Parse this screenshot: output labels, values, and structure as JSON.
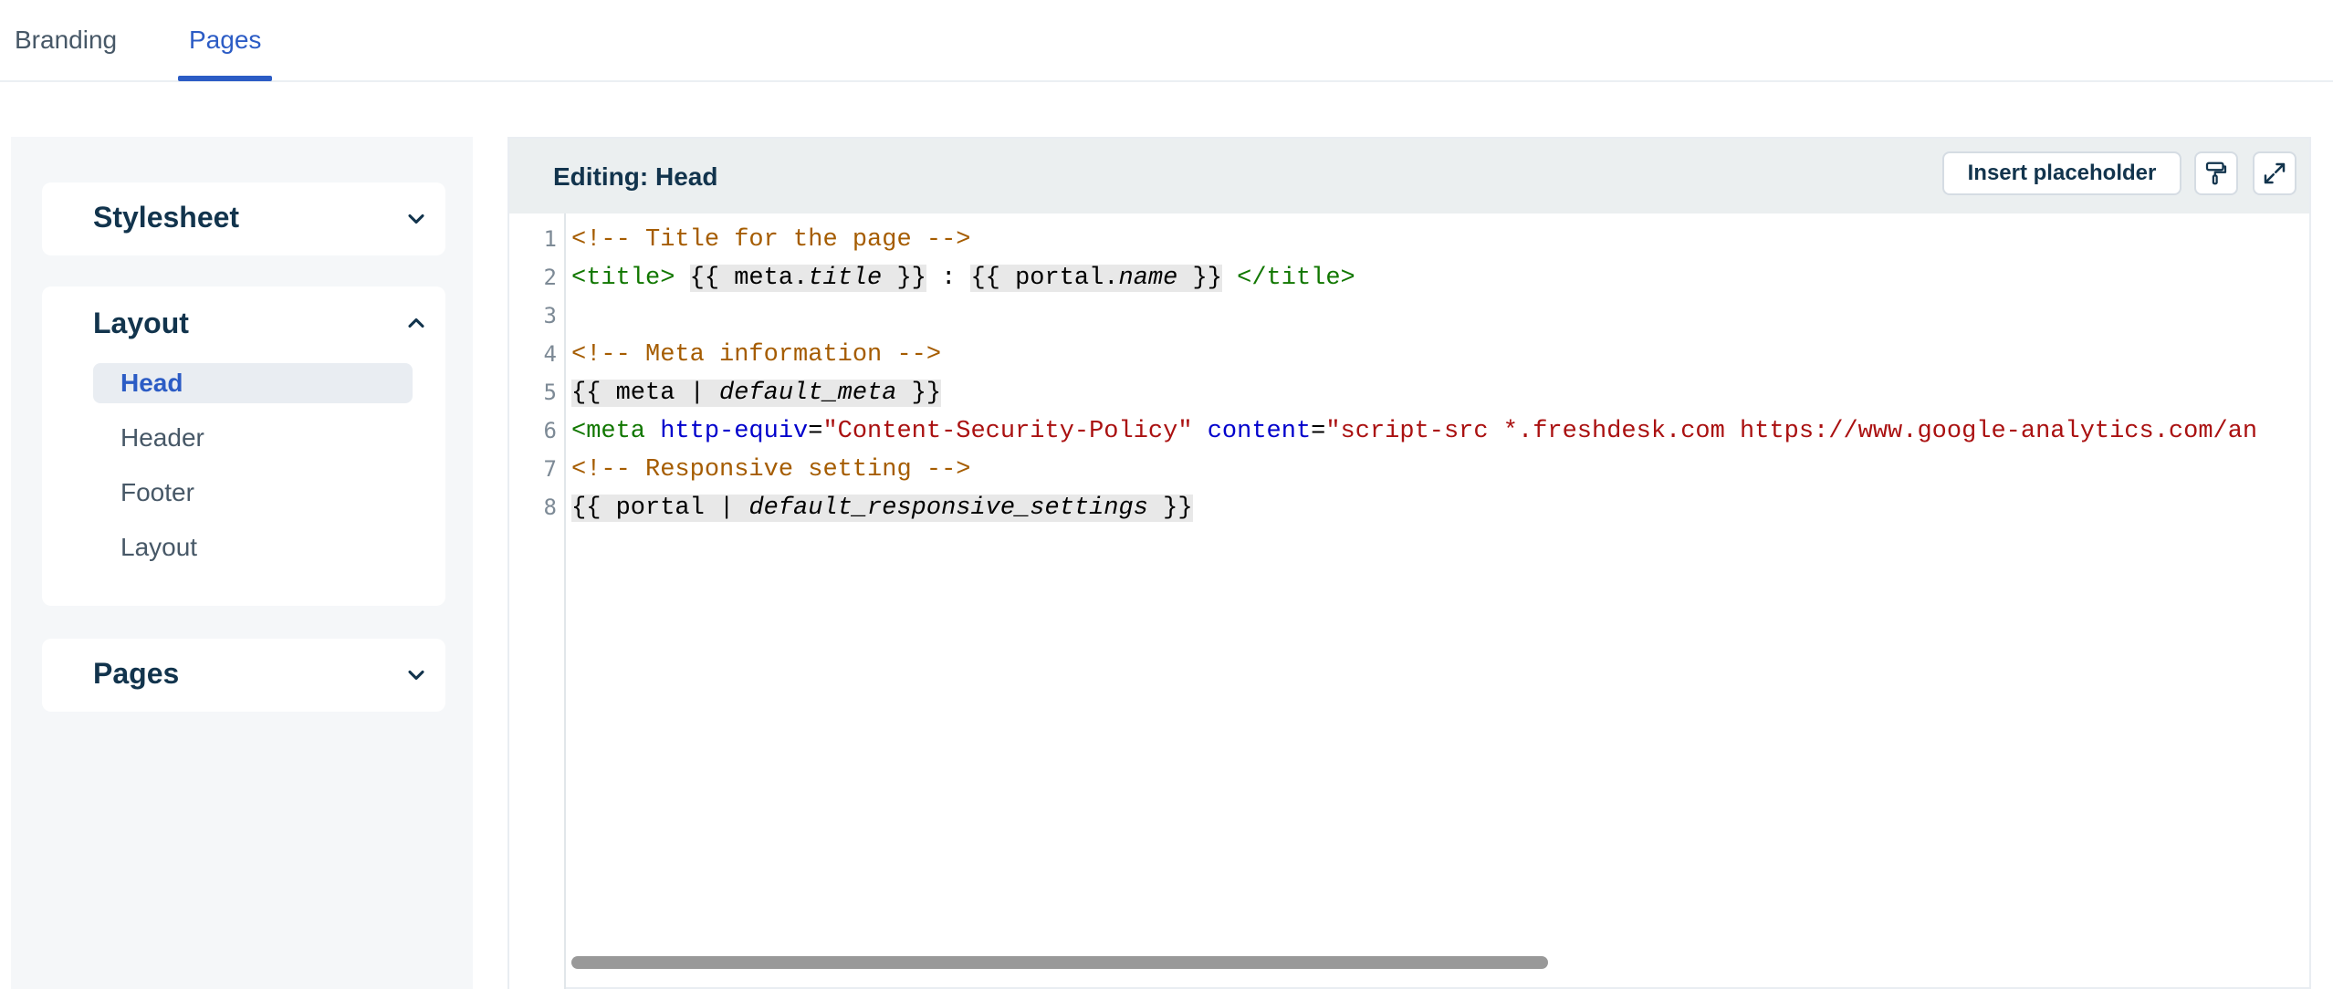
{
  "tabs": [
    {
      "label": "Branding",
      "active": false
    },
    {
      "label": "Pages",
      "active": true
    }
  ],
  "sidebar": {
    "stylesheet": {
      "title": "Stylesheet",
      "expanded": false,
      "icon": "chevron-down-icon"
    },
    "layout": {
      "title": "Layout",
      "expanded": true,
      "icon": "chevron-up-icon",
      "items": [
        {
          "label": "Head",
          "active": true
        },
        {
          "label": "Header",
          "active": false
        },
        {
          "label": "Footer",
          "active": false
        },
        {
          "label": "Layout",
          "active": false
        }
      ]
    },
    "pages": {
      "title": "Pages",
      "expanded": false,
      "icon": "chevron-down-icon"
    }
  },
  "editor": {
    "title": "Editing: Head",
    "insert_placeholder_label": "Insert placeholder",
    "icons": [
      "paint-roller-icon",
      "expand-icon"
    ],
    "line_numbers": [
      "1",
      "2",
      "3",
      "4",
      "5",
      "6",
      "7",
      "8"
    ],
    "code": {
      "l1": "<!-- Title for the page -->",
      "l2_open": "<title>",
      "l2_q1_open": "{{ meta.",
      "l2_q1_italic": "title",
      "l2_q1_close": " }}",
      "l2_sep": " : ",
      "l2_q2_open": "{{ portal.",
      "l2_q2_italic": "name",
      "l2_q2_close": " }}",
      "l2_close": "</title>",
      "l4": "<!-- Meta information -->",
      "l5_open": "{{ meta | ",
      "l5_italic": "default_meta",
      "l5_close": " }}",
      "l6_tag": "<meta",
      "l6_attr1": "http-equiv",
      "l6_eq1": "=",
      "l6_val1": "\"Content-Security-Policy\"",
      "l6_attr2": "content",
      "l6_eq2": "=",
      "l6_val2": "\"script-src *.freshdesk.com https://www.google-analytics.com/an",
      "l7": "<!-- Responsive setting -->",
      "l8_open": "{{ portal | ",
      "l8_italic": "default_responsive_settings",
      "l8_close": " }}"
    }
  },
  "colors": {
    "accent": "#2c5cc5",
    "comment": "#a55c00",
    "tag": "#117700",
    "attribute": "#0000cc",
    "string": "#aa1111"
  }
}
